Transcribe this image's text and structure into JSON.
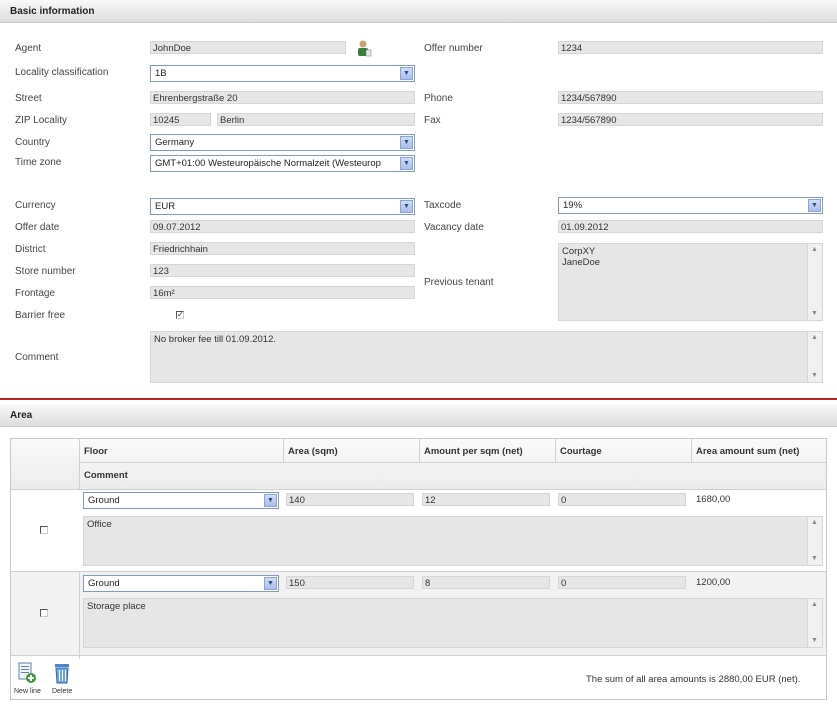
{
  "basic": {
    "title": "Basic information",
    "agent_label": "Agent",
    "agent_value": "JohnDoe",
    "locality_label": "Locality classification",
    "locality_value": "1B",
    "street_label": "Street",
    "street_value": "Ehrenbergstraße 20",
    "zip_label": "ZIP Locality",
    "zip_value": "10245",
    "city_value": "Berlin",
    "country_label": "Country",
    "country_value": "Germany",
    "timezone_label": "Time zone",
    "timezone_value": "GMT+01:00 Westeuropäische Normalzeit (Westeurop",
    "offer_number_label": "Offer number",
    "offer_number_value": "1234",
    "phone_label": "Phone",
    "phone_value": "1234/567890",
    "fax_label": "Fax",
    "fax_value": "1234/567890",
    "currency_label": "Currency",
    "currency_value": "EUR",
    "offer_date_label": "Offer date",
    "offer_date_value": "09.07.2012",
    "district_label": "District",
    "district_value": "Friedrichhain",
    "store_number_label": "Store number",
    "store_number_value": "123",
    "frontage_label": "Frontage",
    "frontage_value": "16m²",
    "barrier_label": "Barrier free",
    "barrier_checked": "✓",
    "comment_label": "Comment",
    "comment_value": "No broker fee till 01.09.2012.",
    "taxcode_label": "Taxcode",
    "taxcode_value": "19%",
    "vacancy_label": "Vacancy date",
    "vacancy_value": "01.09.2012",
    "prev_tenant_label": "Previous tenant",
    "prev_tenant_line1": "CorpXY",
    "prev_tenant_line2": "JaneDoe"
  },
  "area": {
    "title": "Area",
    "headers": {
      "floor": "Floor",
      "area": "Area (sqm)",
      "amount": "Amount per sqm (net)",
      "courtage": "Courtage",
      "sum": "Area amount sum (net)",
      "comment": "Comment"
    },
    "rows": [
      {
        "floor": "Ground",
        "area": "140",
        "amount": "12",
        "courtage": "0",
        "sum": "1680,00",
        "comment": "Office"
      },
      {
        "floor": "Ground",
        "area": "150",
        "amount": "8",
        "courtage": "0",
        "sum": "1200,00",
        "comment": "Storage place"
      }
    ],
    "new_line_label": "New line",
    "delete_label": "Delete",
    "total_text": "The sum of all area amounts is 2880,00 EUR (net)."
  },
  "colors": {
    "accent_red": "#b22222",
    "select_border": "#7f9db9"
  },
  "icons": {
    "agent": "person-icon",
    "new_line": "new-document-icon",
    "delete": "trash-icon"
  }
}
